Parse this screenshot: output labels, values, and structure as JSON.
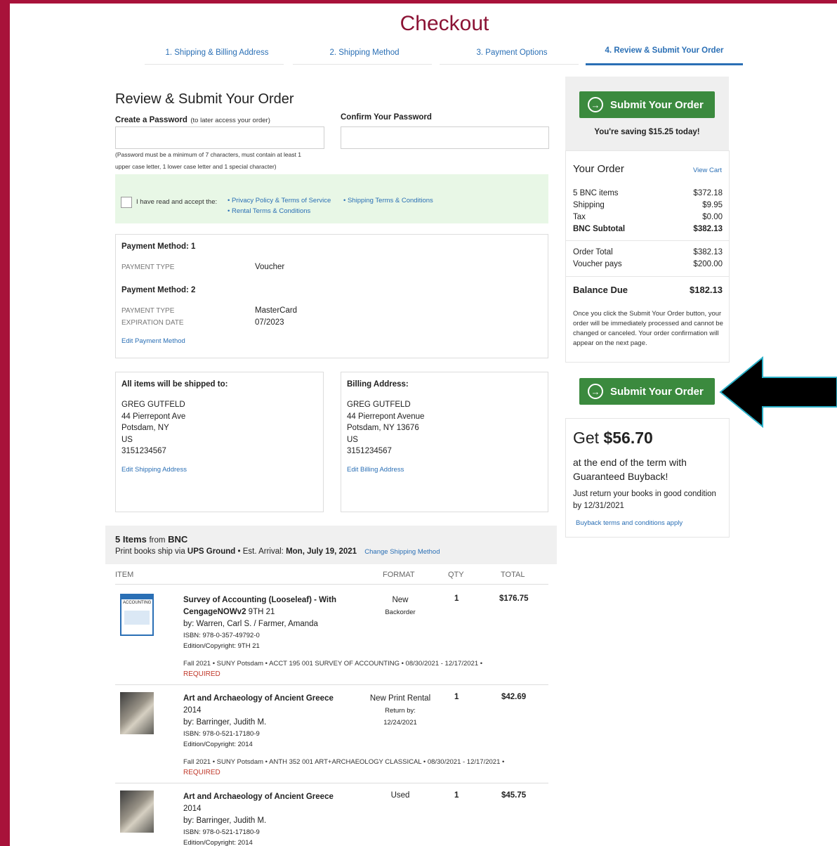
{
  "header": {
    "title": "Checkout"
  },
  "steps": [
    {
      "label": "1. Shipping & Billing Address"
    },
    {
      "label": "2. Shipping Method"
    },
    {
      "label": "3. Payment Options"
    },
    {
      "label": "4. Review & Submit Your Order"
    }
  ],
  "review": {
    "heading": "Review & Submit Your Order",
    "password_label": "Create a Password",
    "password_hint": "(to later access your order)",
    "confirm_label": "Confirm Your Password",
    "password_rules_1": "(Password must be a minimum of 7 characters, must contain at least 1",
    "password_rules_2": "upper case letter, 1 lower case letter and 1 special character)",
    "accept_text": "I have read and accept the:",
    "links": {
      "privacy": "• Privacy Policy & Terms of Service",
      "shipping": "• Shipping Terms & Conditions",
      "rental": "• Rental Terms & Conditions"
    }
  },
  "payment": {
    "method1_title": "Payment Method: 1",
    "method1_type_label": "PAYMENT TYPE",
    "method1_type": "Voucher",
    "method2_title": "Payment Method: 2",
    "method2_type_label": "PAYMENT TYPE",
    "method2_type": "MasterCard",
    "method2_exp_label": "EXPIRATION DATE",
    "method2_exp": "07/2023",
    "edit": "Edit Payment Method"
  },
  "shipping": {
    "title": "All items will be shipped to:",
    "lines": [
      "GREG GUTFELD",
      "44 Pierrepont Ave",
      "Potsdam, NY",
      "US",
      "3151234567"
    ],
    "edit": "Edit Shipping Address"
  },
  "billing": {
    "title": "Billing Address:",
    "lines": [
      "GREG GUTFELD",
      "44 Pierrepont Avenue",
      "Potsdam, NY 13676",
      "US",
      "3151234567"
    ],
    "edit": "Edit Billing Address"
  },
  "items_section": {
    "count": "5 Items",
    "from": "from",
    "vendor": "BNC",
    "ship_prefix": "Print books ship via",
    "carrier": "UPS Ground",
    "est": "• Est. Arrival:",
    "arrival": "Mon, July 19, 2021",
    "change": "Change Shipping Method",
    "cols": {
      "item": "ITEM",
      "format": "FORMAT",
      "qty": "QTY",
      "total": "TOTAL"
    }
  },
  "items": [
    {
      "title1": "Survey of Accounting (Looseleaf) - With",
      "title2": "CengageNOWv2",
      "edition": "9TH 21",
      "by": "by: Warren, Carl S. / Farmer, Amanda",
      "isbn": "ISBN: 978-0-357-49792-0",
      "copyright": "Edition/Copyright: 9TH 21",
      "format": "New",
      "format_sub": "Backorder",
      "qty": "1",
      "total": "$176.75",
      "course": "Fall 2021  •  SUNY Potsdam  •  ACCT 195 001 SURVEY OF ACCOUNTING  •  08/30/2021 - 12/17/2021  •",
      "required": "REQUIRED",
      "cover_text": "ACCOUNTING"
    },
    {
      "title1": "Art and Archaeology of Ancient Greece",
      "year": "2014",
      "by": "by: Barringer, Judith M.",
      "isbn": "ISBN: 978-0-521-17180-9",
      "copyright": "Edition/Copyright: 2014",
      "format": "New Print Rental",
      "format_sub": "Return by:",
      "format_sub2": "12/24/2021",
      "qty": "1",
      "total": "$42.69",
      "course": "Fall 2021  •  SUNY Potsdam  •  ANTH 352 001 ART+ARCHAEOLOGY CLASSICAL  •  08/30/2021 - 12/17/2021  •",
      "required": "REQUIRED"
    },
    {
      "title1": "Art and Archaeology of Ancient Greece",
      "year": "2014",
      "by": "by: Barringer, Judith M.",
      "isbn": "ISBN: 978-0-521-17180-9",
      "copyright": "Edition/Copyright: 2014",
      "format": "Used",
      "qty": "1",
      "total": "$45.75"
    }
  ],
  "sidebar": {
    "submit_label": "Submit Your Order",
    "saving": "You're saving $15.25 today!",
    "your_order": "Your Order",
    "view_cart": "View Cart",
    "rows": [
      {
        "label": "5 BNC items",
        "value": "$372.18"
      },
      {
        "label": "Shipping",
        "value": "$9.95"
      },
      {
        "label": "Tax",
        "value": "$0.00"
      },
      {
        "label": "BNC Subtotal",
        "value": "$382.13"
      }
    ],
    "order_total_label": "Order Total",
    "order_total": "$382.13",
    "voucher_label": "Voucher pays",
    "voucher": "$200.00",
    "balance_label": "Balance Due",
    "balance": "$182.13",
    "notice": "Once you click the Submit Your Order button, your order will be immediately processed and cannot be changed or canceled. Your order confirmation will appear on the next page.",
    "get_prefix": "Get",
    "get_amount": "$56.70",
    "buyback_1": "at the end of the term with",
    "buyback_2": "Guaranteed Buyback!",
    "buyback_return": "Just return your books in good condition",
    "buyback_by": "by 12/31/2021",
    "buyback_terms": "Buyback terms and conditions apply"
  },
  "colors": {
    "frame": "#a8123a",
    "accent": "#2a6fb5",
    "green": "#3b8a3e",
    "title": "#8b1234"
  }
}
